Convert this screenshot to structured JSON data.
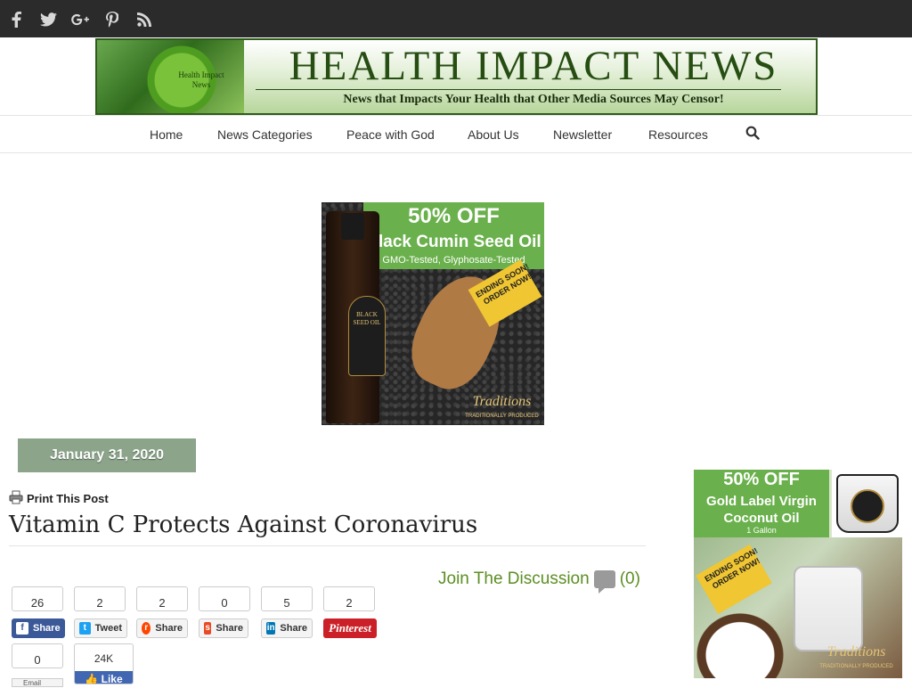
{
  "social": [
    {
      "name": "facebook",
      "icon": "facebook-icon",
      "glyph": "f"
    },
    {
      "name": "twitter",
      "icon": "twitter-icon",
      "glyph": "t"
    },
    {
      "name": "google-plus",
      "icon": "google-plus-icon",
      "glyph": "g+"
    },
    {
      "name": "pinterest",
      "icon": "pinterest-icon",
      "glyph": "P"
    },
    {
      "name": "rss",
      "icon": "rss-icon",
      "glyph": "rss"
    }
  ],
  "banner": {
    "title": "HEALTH IMPACT NEWS",
    "tagline": "News that Impacts Your Health that Other Media Sources May Censor!",
    "circle_text": "Health Impact News"
  },
  "nav": {
    "items": [
      "Home",
      "News Categories",
      "Peace with God",
      "About Us",
      "Newsletter",
      "Resources"
    ],
    "search_icon": "search-icon"
  },
  "ad_top": {
    "headline": "50% OFF",
    "product": "Black Cumin Seed Oil",
    "sub": "GMO-Tested, Glyphosate-Tested",
    "tag": "ENDING SOON! ORDER NOW!",
    "bottle_label": "BLACK SEED OIL",
    "brand": "Traditions",
    "brand_sub": "TRADITIONALLY PRODUCED"
  },
  "post": {
    "date": "January 31, 2020",
    "print_label": "Print This Post",
    "title": "Vitamin C Protects Against Coronavirus",
    "discussion_label": "Join The Discussion",
    "discussion_count": "(0)"
  },
  "share": {
    "buttons": [
      {
        "network": "facebook",
        "count": "26",
        "label": "Share",
        "glyph": "f"
      },
      {
        "network": "twitter",
        "count": "2",
        "label": "Tweet",
        "glyph": "t"
      },
      {
        "network": "reddit",
        "count": "2",
        "label": "Share",
        "glyph": "r"
      },
      {
        "network": "stumbleupon",
        "count": "0",
        "label": "Share",
        "glyph": "su"
      },
      {
        "network": "linkedin",
        "count": "5",
        "label": "Share",
        "glyph": "in"
      },
      {
        "network": "pinterest",
        "count": "2",
        "label": "Pinterest",
        "glyph": "p"
      }
    ],
    "email_count": "0",
    "email_label": "Email",
    "like_count": "24K",
    "like_label": "Like"
  },
  "ad_side": {
    "headline": "50% OFF",
    "product": "Gold Label Virgin Coconut Oil",
    "size": "1 Gallon",
    "tag": "ENDING SOON! ORDER NOW!",
    "brand": "Traditions",
    "brand_sub": "TRADITIONALLY PRODUCED"
  },
  "colors": {
    "topbar": "#2b2b2b",
    "date_box": "#8ba48a",
    "discussion": "#5b8f22",
    "facebook": "#3b5998",
    "pinterest": "#cb2027",
    "ad_green": "#6ab04c"
  }
}
